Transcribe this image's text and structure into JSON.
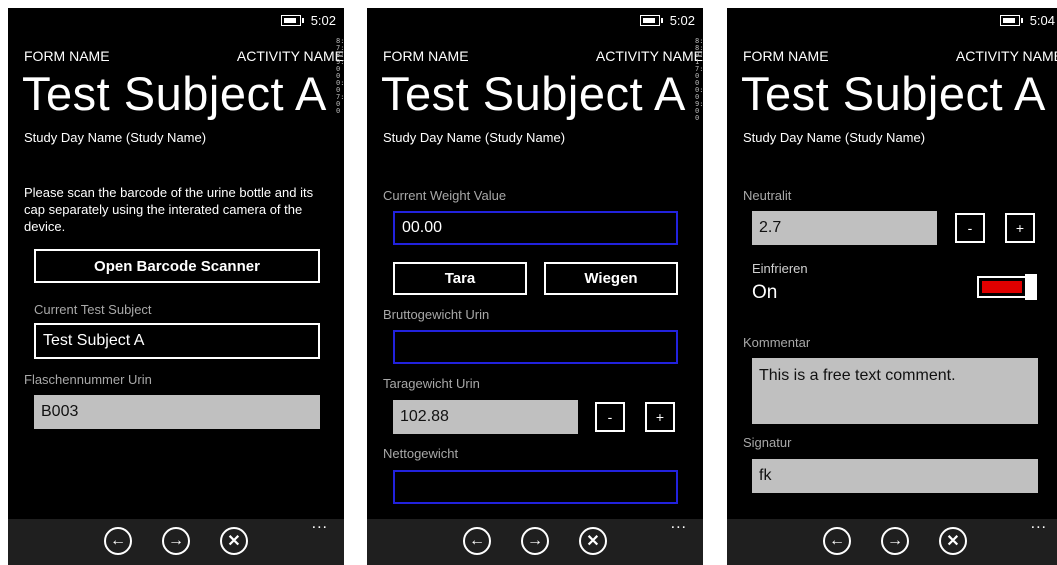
{
  "status": {
    "time_1": "5:02",
    "time_2": "5:02",
    "time_3": "5:04"
  },
  "header": {
    "form_name": "FORM NAME",
    "activity_name": "ACTIVITY NAME",
    "subject_title": "Test Subject A",
    "study_line": "Study Day Name (Study Name)"
  },
  "screen1": {
    "instruction": "Please scan the barcode of the urine bottle and its cap separately using the interated camera of the device.",
    "scanner_button": "Open Barcode Scanner",
    "current_subject_label": "Current Test Subject",
    "current_subject_value": "Test Subject A",
    "bottle_label": "Flaschennummer Urin",
    "bottle_value": "B003"
  },
  "screen2": {
    "weight_label": "Current Weight Value",
    "weight_value": "00.00",
    "tara_button": "Tara",
    "wiegen_button": "Wiegen",
    "gross_label": "Bruttogewicht Urin",
    "gross_value": "",
    "tare_label": "Taragewicht Urin",
    "tare_value": "102.88",
    "net_label": "Nettogewicht",
    "net_value": ""
  },
  "screen3": {
    "neutral_label": "Neutralit",
    "neutral_value": "2.7",
    "freeze_label": "Einfrieren",
    "freeze_value": "On",
    "comment_label": "Kommentar",
    "comment_value": "This is a free text comment.",
    "signature_label": "Signatur",
    "signature_value": "fk"
  },
  "steppers": {
    "minus": "-",
    "plus": "+"
  },
  "appbar": {
    "back_glyph": "←",
    "forward_glyph": "→",
    "cancel_glyph": "✕",
    "more_glyph": "..."
  },
  "side_strip": {
    "strip_1": "8:7:8:9:000:07:00",
    "strip_2": "8:8:9:17:000:09:00"
  },
  "colors": {
    "accent_blue": "#2222dd",
    "toggle_red": "#e00000",
    "field_gray": "#c0c0c0",
    "appbar": "#1f1f1f"
  }
}
